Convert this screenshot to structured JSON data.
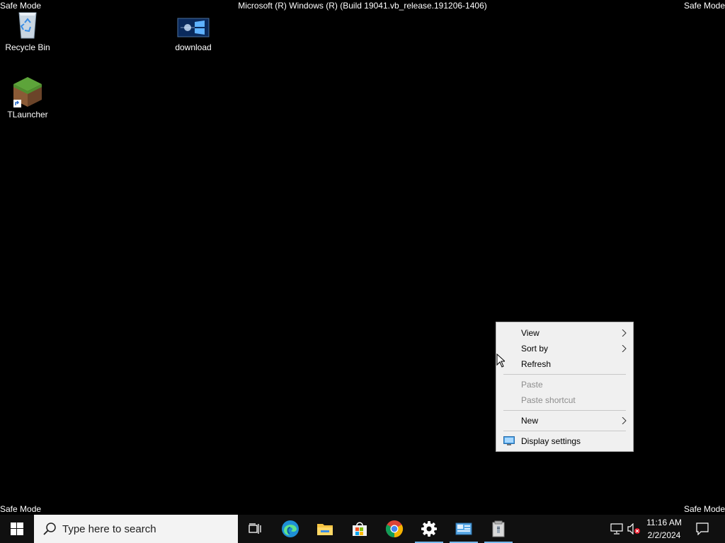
{
  "screen": {
    "safe_mode_label": "Safe Mode",
    "build_title": "Microsoft (R) Windows (R) (Build 19041.vb_release.191206-1406)"
  },
  "desktop_icons": [
    {
      "label": "Recycle Bin",
      "icon": "recycle-bin-icon"
    },
    {
      "label": "download",
      "icon": "image-file-icon"
    },
    {
      "label": "TLauncher",
      "icon": "tlauncher-shortcut-icon"
    }
  ],
  "context_menu": {
    "items": [
      {
        "label": "View",
        "has_submenu": true,
        "disabled": false
      },
      {
        "label": "Sort by",
        "has_submenu": true,
        "disabled": false
      },
      {
        "label": "Refresh",
        "has_submenu": false,
        "disabled": false
      },
      {
        "label": "Paste",
        "has_submenu": false,
        "disabled": true
      },
      {
        "label": "Paste shortcut",
        "has_submenu": false,
        "disabled": true
      },
      {
        "label": "New",
        "has_submenu": true,
        "disabled": false
      },
      {
        "label": "Display settings",
        "has_submenu": false,
        "disabled": false,
        "icon": "display-settings-icon"
      }
    ]
  },
  "taskbar": {
    "search_placeholder": "Type here to search",
    "pinned": [
      "start-icon",
      "task-view-icon",
      "edge-icon",
      "file-explorer-icon",
      "store-icon",
      "chrome-icon",
      "settings-icon",
      "control-panel-icon",
      "archive-app-icon"
    ],
    "tray": {
      "time": "11:16 AM",
      "date": "2/2/2024",
      "icons": [
        "network-icon",
        "volume-muted-icon",
        "notifications-icon"
      ]
    }
  },
  "colors": {
    "desktop_bg": "#000000",
    "taskbar_bg": "#101010",
    "menu_bg": "#f0f0f0",
    "running_indicator": "#76b9ed"
  }
}
